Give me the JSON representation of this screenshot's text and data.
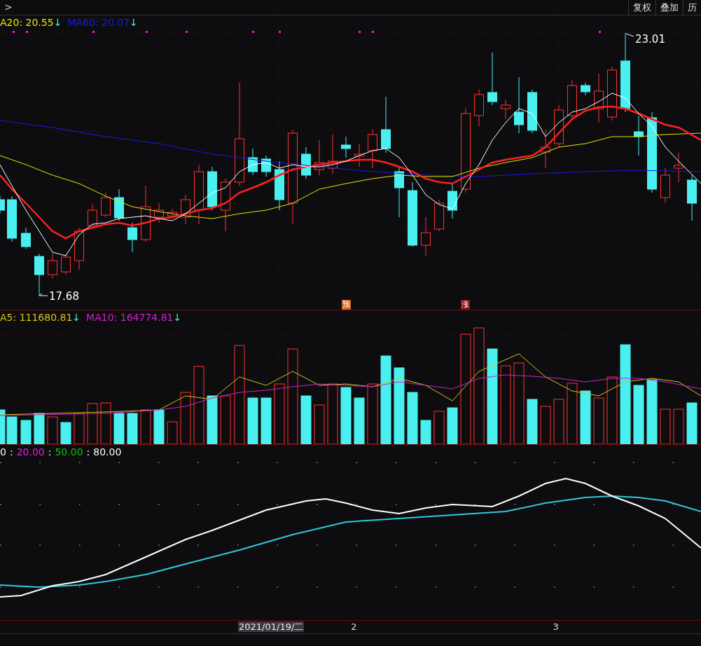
{
  "toolbar": {
    "nav_glyph": ">",
    "buttons": [
      "复权",
      "叠加",
      "历"
    ]
  },
  "price_panel": {
    "legend": [
      {
        "label": "A20: 20.55",
        "arrow": "↓",
        "color": "#e6e600"
      },
      {
        "label": "MA60: 20.07",
        "arrow": "↓",
        "color": "#1a1ae6"
      }
    ],
    "high_label": "23.01",
    "low_label": "17.68",
    "markers": [
      {
        "text": "预",
        "color": "#d0621a"
      },
      {
        "text": "涨",
        "color": "#8a0a0a"
      }
    ]
  },
  "volume_panel": {
    "legend": [
      {
        "label": "A5: 111680.81",
        "arrow": "↓",
        "color": "#d4c414"
      },
      {
        "label": "MA10: 164774.81",
        "arrow": "↓",
        "color": "#cc22cc"
      }
    ]
  },
  "kdj_panel": {
    "legend": [
      {
        "value": "0",
        "color": "#ffffff"
      },
      {
        "prefix": ":",
        "value": "20.00",
        "color": "#e020e0"
      },
      {
        "prefix": ":",
        "value": "50.00",
        "color": "#10c010"
      },
      {
        "prefix": ":",
        "value": "80.00",
        "color": "#ffffff"
      }
    ]
  },
  "x_axis": {
    "labels": [
      {
        "text": "2021/01/19/二",
        "selected": true
      },
      {
        "text": "2",
        "selected": false
      },
      {
        "text": "3",
        "selected": false
      }
    ]
  }
}
